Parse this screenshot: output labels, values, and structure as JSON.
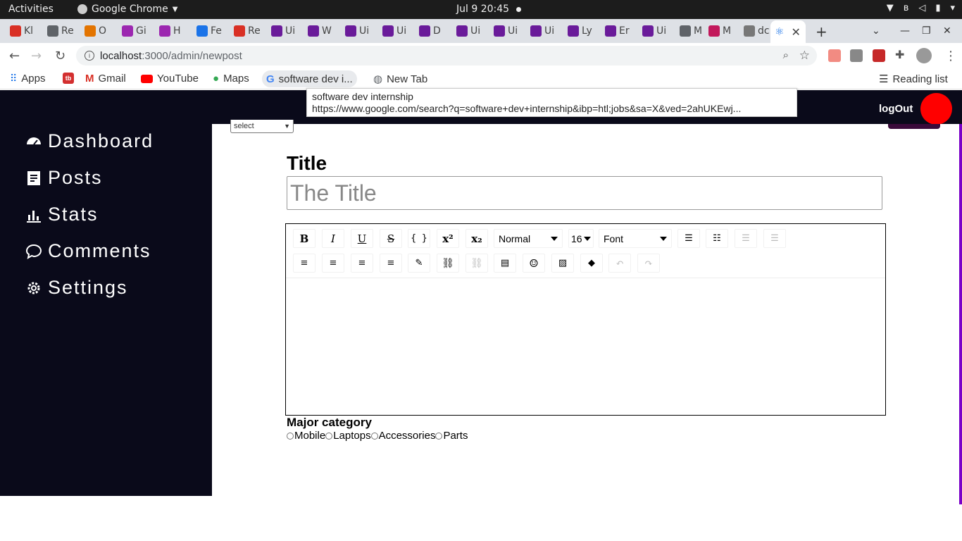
{
  "os": {
    "activities": "Activities",
    "app_name": "Google Chrome",
    "clock": "Jul 9  20:45"
  },
  "tabs": [
    {
      "label": "Kl",
      "color": "#d93025"
    },
    {
      "label": "Re",
      "color": "#5f6368"
    },
    {
      "label": "O",
      "color": "#e37400"
    },
    {
      "label": "Gi",
      "color": "#9c27b0"
    },
    {
      "label": "H",
      "color": "#9c27b0"
    },
    {
      "label": "Fe",
      "color": "#1a73e8"
    },
    {
      "label": "Re",
      "color": "#d93025"
    },
    {
      "label": "Ui",
      "color": "#6a1b9a"
    },
    {
      "label": "W",
      "color": "#6a1b9a"
    },
    {
      "label": "Ui",
      "color": "#6a1b9a"
    },
    {
      "label": "Ui",
      "color": "#6a1b9a"
    },
    {
      "label": "D",
      "color": "#6a1b9a"
    },
    {
      "label": "Ui",
      "color": "#6a1b9a"
    },
    {
      "label": "Ui",
      "color": "#6a1b9a"
    },
    {
      "label": "Ui",
      "color": "#6a1b9a"
    },
    {
      "label": "Ly",
      "color": "#6a1b9a"
    },
    {
      "label": "Er",
      "color": "#6a1b9a"
    },
    {
      "label": "Ui",
      "color": "#6a1b9a"
    },
    {
      "label": "M",
      "color": "#5f6368"
    },
    {
      "label": "M",
      "color": "#c2185b"
    },
    {
      "label": "dc",
      "color": "#777"
    }
  ],
  "address": {
    "host": "localhost",
    "path": ":3000/admin/newpost"
  },
  "bookmarks": {
    "apps": "Apps",
    "gmail": "Gmail",
    "youtube": "YouTube",
    "maps": "Maps",
    "search": "software dev i...",
    "newtab": "New Tab",
    "reading_list": "Reading list"
  },
  "tooltip": {
    "line1": "software dev internship",
    "line2": "https://www.google.com/search?q=software+dev+internship&ibp=htl;jobs&sa=X&ved=2ahUKEwj..."
  },
  "header": {
    "logout": "logOut"
  },
  "sidebar": {
    "items": [
      {
        "label": "Dashboard"
      },
      {
        "label": "Posts"
      },
      {
        "label": "Stats"
      },
      {
        "label": "Comments"
      },
      {
        "label": "Settings"
      }
    ]
  },
  "form": {
    "select_value": "select",
    "title_label": "Title",
    "title_placeholder": "The Title",
    "block_type": "Normal",
    "font_size": "16",
    "font_family": "Font",
    "major_label": "Major category",
    "categories": [
      "Mobile",
      "Laptops",
      "Accessories",
      "Parts"
    ]
  },
  "colors": {
    "sidebar_bg": "#0a0a1a",
    "avatar": "#ff0000",
    "accent_strip": "#7a00c8"
  }
}
